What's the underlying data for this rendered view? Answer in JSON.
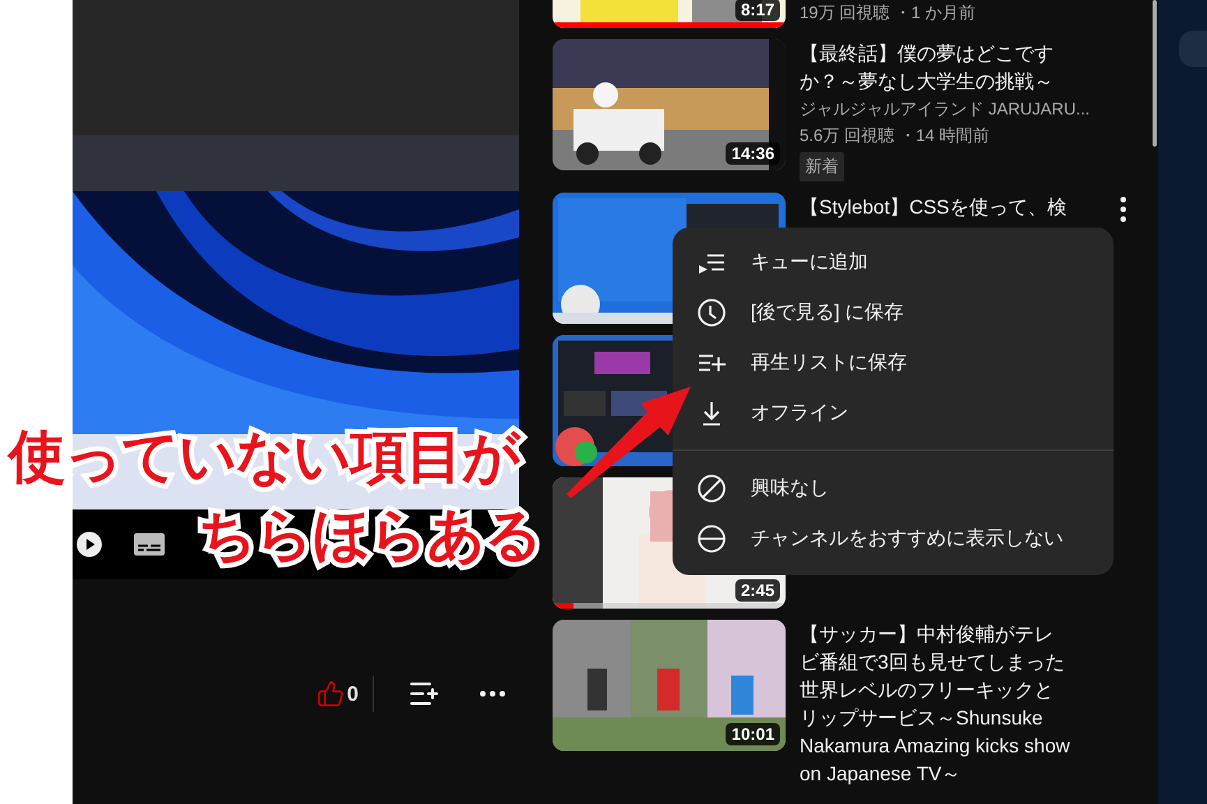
{
  "actions": {
    "like_count": "0",
    "liked": true
  },
  "videos": [
    {
      "duration": "8:17",
      "meta": "19万 回視聴 ・1 か月前",
      "level": 1,
      "menu_open": false
    },
    {
      "duration": "14:36",
      "title": "【最終話】僕の夢はどこですか？～夢なし大学生の挑戦～",
      "channel": "ジャルジャルアイランド JARUJARU...",
      "meta": "5.6万 回視聴 ・14 時間前",
      "badge": "新着",
      "menu_open": false
    },
    {
      "title": "【Stylebot】CSSを使って、検",
      "menu_open": true
    },
    {
      "menu_open": false
    },
    {
      "duration": "2:45",
      "level": 0.09,
      "menu_open": false
    },
    {
      "duration": "10:01",
      "title": "【サッカー】中村俊輔がテレビ番組で3回も見せてしまった世界レベルのフリーキックとリップサービス～Shunsuke Nakamura Amazing kicks show on Japanese TV～",
      "menu_open": false
    }
  ],
  "menu": {
    "sections": [
      [
        {
          "kind": "queue",
          "label": "キューに追加"
        },
        {
          "kind": "watch-later",
          "label": "[後で見る] に保存"
        },
        {
          "kind": "playlist",
          "label": "再生リストに保存"
        },
        {
          "kind": "download",
          "label": "オフライン"
        }
      ],
      [
        {
          "kind": "not-interested",
          "label": "興味なし"
        },
        {
          "kind": "block-channel",
          "label": "チャンネルをおすすめに表示しない"
        }
      ]
    ]
  },
  "annotation": {
    "lines": [
      "使っていない項目が",
      "ちらほらある"
    ]
  }
}
